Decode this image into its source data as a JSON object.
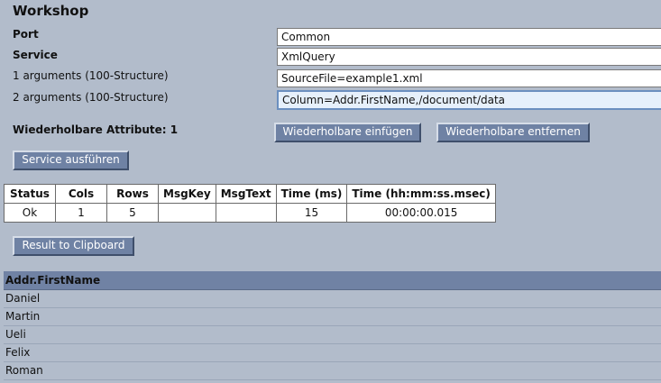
{
  "page": {
    "title": "Workshop"
  },
  "form": {
    "port": {
      "label": "Port",
      "value": "Common"
    },
    "service": {
      "label": "Service",
      "value": "XmlQuery"
    },
    "arg1": {
      "label": "1 arguments (100-Structure)",
      "value": "SourceFile=example1.xml"
    },
    "arg2": {
      "label": "2 arguments (100-Structure)",
      "value": "Column=Addr.FirstName,/document/data"
    }
  },
  "repeatable": {
    "label": "Wiederholbare Attribute: 1",
    "insert_button": "Wiederholbare einfügen",
    "remove_button": "Wiederholbare entfernen"
  },
  "actions": {
    "run_button": "Service ausführen",
    "clipboard_button": "Result to Clipboard"
  },
  "stats": {
    "headers": [
      "Status",
      "Cols",
      "Rows",
      "MsgKey",
      "MsgText",
      "Time (ms)",
      "Time (hh:mm:ss.msec)"
    ],
    "row": [
      "Ok",
      "1",
      "5",
      "",
      "",
      "15",
      "00:00:00.015"
    ]
  },
  "result": {
    "header": "Addr.FirstName",
    "rows": [
      "Daniel",
      "Martin",
      "Ueli",
      "Felix",
      "Roman"
    ]
  }
}
